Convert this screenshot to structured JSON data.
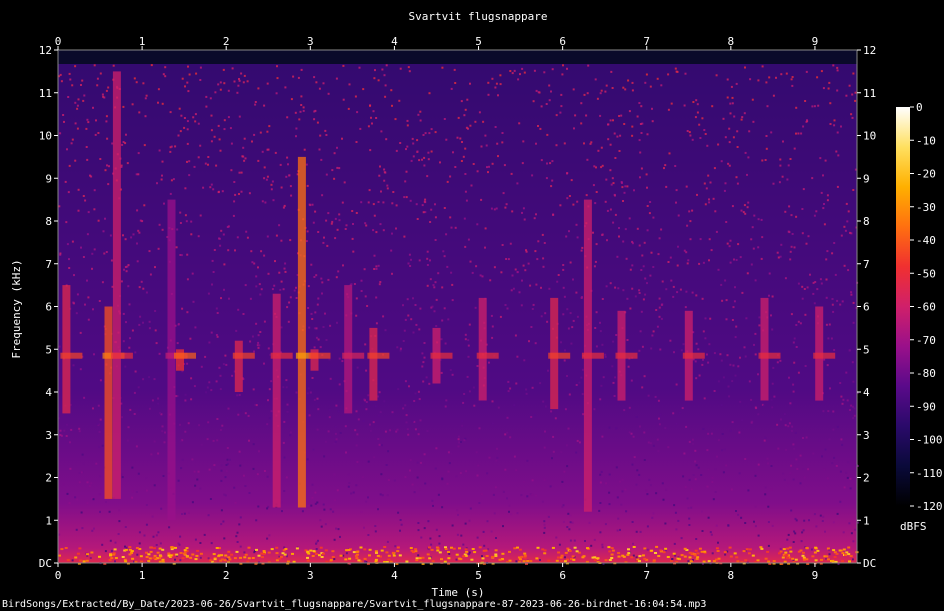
{
  "chart_data": {
    "type": "heatmap",
    "title": "Svartvit flugsnappare",
    "xlabel": "Time (s)",
    "ylabel": "Frequency (kHz)",
    "xlim": [
      0,
      9.5
    ],
    "ylim": [
      0,
      12
    ],
    "x_ticks": [
      "0",
      "1",
      "2",
      "3",
      "4",
      "5",
      "6",
      "7",
      "8",
      "9"
    ],
    "y_ticks": [
      "DC",
      "1",
      "2",
      "3",
      "4",
      "5",
      "6",
      "7",
      "8",
      "9",
      "10",
      "11",
      "12"
    ],
    "colorbar": {
      "label": "dBFS",
      "range": [
        -120,
        0
      ],
      "ticks": [
        "0",
        "-10",
        "-20",
        "-30",
        "-40",
        "-50",
        "-60",
        "-70",
        "-80",
        "-90",
        "-100",
        "-110",
        "-120"
      ]
    },
    "calls": [
      {
        "t": 0.1,
        "f_low": 3.5,
        "f_high": 6.5,
        "level": 0.55
      },
      {
        "t": 0.6,
        "f_low": 1.5,
        "f_high": 6.0,
        "level": 0.65
      },
      {
        "t": 0.7,
        "f_low": 1.5,
        "f_high": 11.5,
        "level": 0.5
      },
      {
        "t": 1.35,
        "f_low": 1.0,
        "f_high": 8.5,
        "level": 0.4
      },
      {
        "t": 1.45,
        "f_low": 4.5,
        "f_high": 5.0,
        "level": 0.6
      },
      {
        "t": 2.15,
        "f_low": 4.0,
        "f_high": 5.2,
        "level": 0.55
      },
      {
        "t": 2.6,
        "f_low": 1.3,
        "f_high": 6.3,
        "level": 0.5
      },
      {
        "t": 2.9,
        "f_low": 1.3,
        "f_high": 9.5,
        "level": 0.7
      },
      {
        "t": 3.05,
        "f_low": 4.5,
        "f_high": 5.0,
        "level": 0.55
      },
      {
        "t": 3.45,
        "f_low": 3.5,
        "f_high": 6.5,
        "level": 0.45
      },
      {
        "t": 3.75,
        "f_low": 3.8,
        "f_high": 5.5,
        "level": 0.55
      },
      {
        "t": 4.5,
        "f_low": 4.2,
        "f_high": 5.5,
        "level": 0.5
      },
      {
        "t": 5.05,
        "f_low": 3.8,
        "f_high": 6.2,
        "level": 0.5
      },
      {
        "t": 5.9,
        "f_low": 3.6,
        "f_high": 6.2,
        "level": 0.55
      },
      {
        "t": 6.3,
        "f_low": 1.2,
        "f_high": 8.5,
        "level": 0.5
      },
      {
        "t": 6.7,
        "f_low": 3.8,
        "f_high": 5.9,
        "level": 0.5
      },
      {
        "t": 7.5,
        "f_low": 3.8,
        "f_high": 5.9,
        "level": 0.5
      },
      {
        "t": 8.4,
        "f_low": 3.8,
        "f_high": 6.2,
        "level": 0.5
      },
      {
        "t": 9.05,
        "f_low": 3.8,
        "f_high": 6.0,
        "level": 0.5
      }
    ]
  },
  "footer": {
    "path": "BirdSongs/Extracted/By_Date/2023-06-26/Svartvit_flugsnappare/Svartvit_flugsnappare-87-2023-06-26-birdnet-16:04:54.mp3"
  },
  "colors": {
    "background": "#000000",
    "text": "#ffffff",
    "colormap": [
      "#000000",
      "#0a0a3a",
      "#2a0a6a",
      "#5a0a8a",
      "#9a108a",
      "#d0206a",
      "#f03030",
      "#ff7010",
      "#ffb000",
      "#ffe060",
      "#ffffff"
    ]
  }
}
